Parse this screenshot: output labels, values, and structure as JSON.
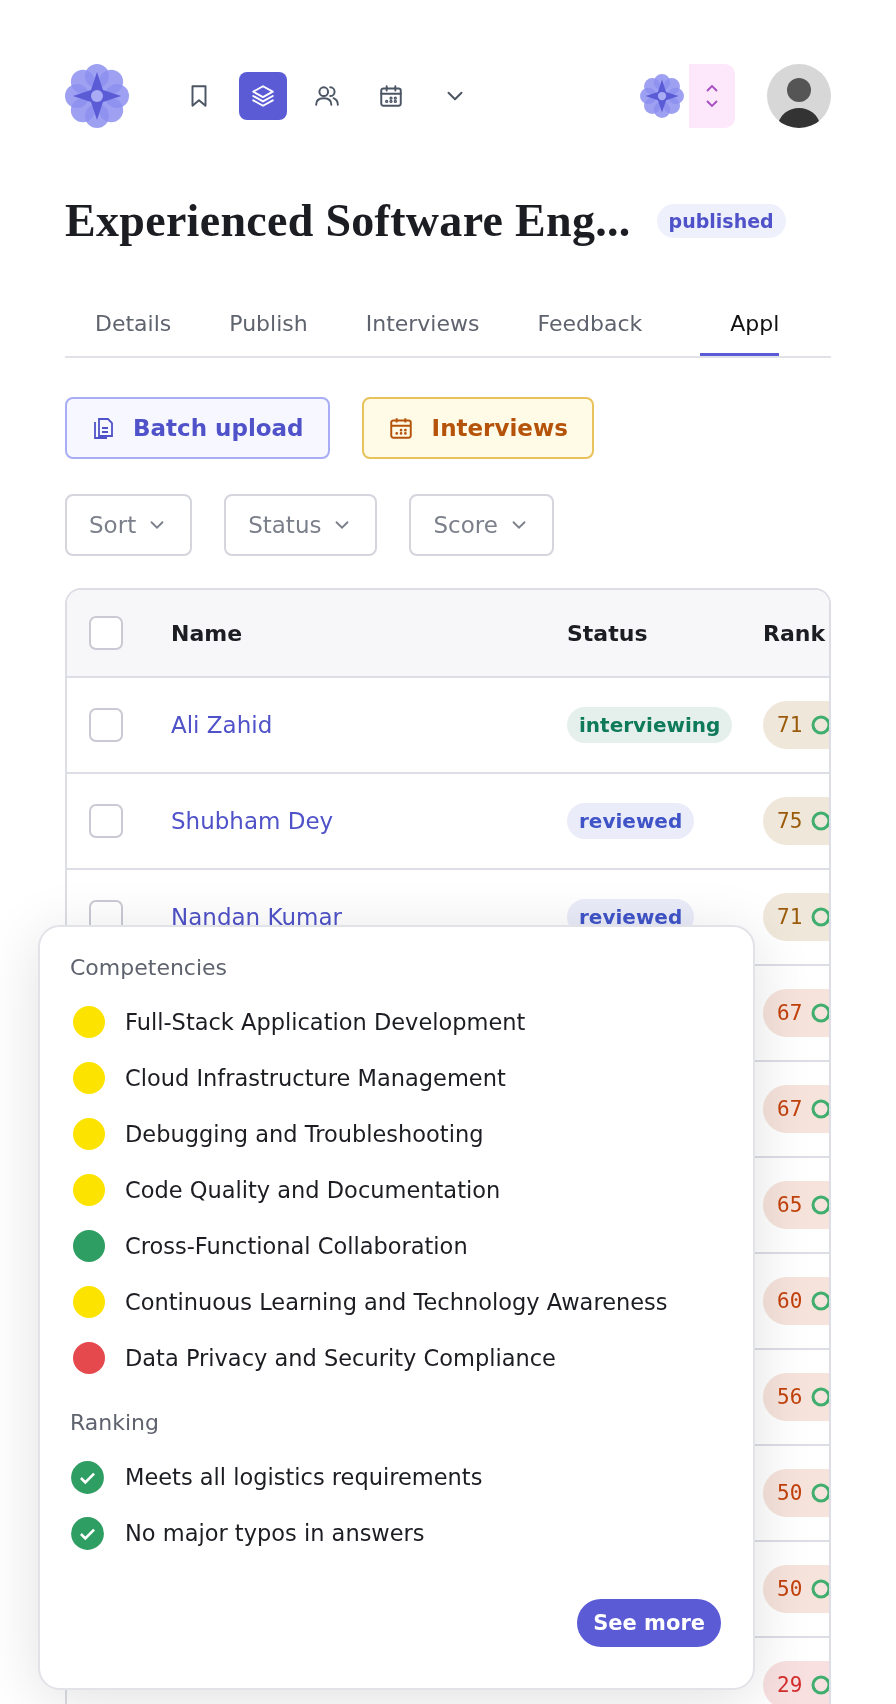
{
  "nav": {
    "items": [
      {
        "kind": "bookmark",
        "selected": false
      },
      {
        "kind": "layers",
        "selected": true
      },
      {
        "kind": "users",
        "selected": false
      },
      {
        "kind": "calendar",
        "selected": false
      },
      {
        "kind": "chevron",
        "selected": false
      }
    ]
  },
  "title": "Experienced Software Eng...",
  "title_badge": "published",
  "tabs": [
    {
      "label": "Details",
      "selected": false
    },
    {
      "label": "Publish",
      "selected": false
    },
    {
      "label": "Interviews",
      "selected": false
    },
    {
      "label": "Feedback",
      "selected": false
    },
    {
      "label": "Appl",
      "selected": true
    }
  ],
  "actions": [
    {
      "label": "Batch upload",
      "kind": "upload"
    },
    {
      "label": "Interviews",
      "kind": "calendar"
    }
  ],
  "filters": [
    "Sort",
    "Status",
    "Score"
  ],
  "table": {
    "select_all_checked": false,
    "columns": [
      "Name",
      "Status",
      "Rank"
    ],
    "rows": [
      {
        "name": "Ali Zahid",
        "status": {
          "label": "interviewing",
          "color": "#0f7a5a"
        },
        "score": {
          "value": "71",
          "color": "#9a5b0b"
        },
        "checked": false
      },
      {
        "name": "Shubham Dey",
        "status": {
          "label": "reviewed",
          "color": "#4054c8"
        },
        "score": {
          "value": "75",
          "color": "#9a5b0b"
        },
        "checked": false
      },
      {
        "name": "Nandan Kumar",
        "status": {
          "label": "reviewed",
          "color": "#4054c8"
        },
        "score": {
          "value": "71",
          "color": "#9a5b0b"
        },
        "checked": false
      },
      {
        "score": {
          "value": "67",
          "color": "#c2410c"
        }
      },
      {
        "score": {
          "value": "67",
          "color": "#c2410c"
        }
      },
      {
        "score": {
          "value": "65",
          "color": "#c2410c"
        }
      },
      {
        "score": {
          "value": "60",
          "color": "#c2410c"
        }
      },
      {
        "score": {
          "value": "56",
          "color": "#c2410c"
        }
      },
      {
        "score": {
          "value": "50",
          "color": "#c2410c"
        }
      },
      {
        "score": {
          "value": "50",
          "color": "#c2410c"
        }
      },
      {
        "score": {
          "value": "29",
          "color": "#d32d2d"
        }
      }
    ]
  },
  "popover": {
    "competencies_title": "Competencies",
    "competencies": [
      {
        "label": "Full-Stack Application Development",
        "color": "#fde400"
      },
      {
        "label": "Cloud Infrastructure Management",
        "color": "#fde400"
      },
      {
        "label": "Debugging and Troubleshooting",
        "color": "#fde400"
      },
      {
        "label": "Code Quality and Documentation",
        "color": "#fde400"
      },
      {
        "label": "Cross-Functional Collaboration",
        "color": "#2f9e63"
      },
      {
        "label": "Continuous Learning and Technology Awareness",
        "color": "#fde400"
      },
      {
        "label": "Data Privacy and Security Compliance",
        "color": "#e5484d"
      }
    ],
    "ranking_title": "Ranking",
    "ranking": [
      {
        "label": "Meets all logistics requirements",
        "met": true
      },
      {
        "label": "No major typos in answers",
        "met": true
      }
    ],
    "button": "See more"
  }
}
